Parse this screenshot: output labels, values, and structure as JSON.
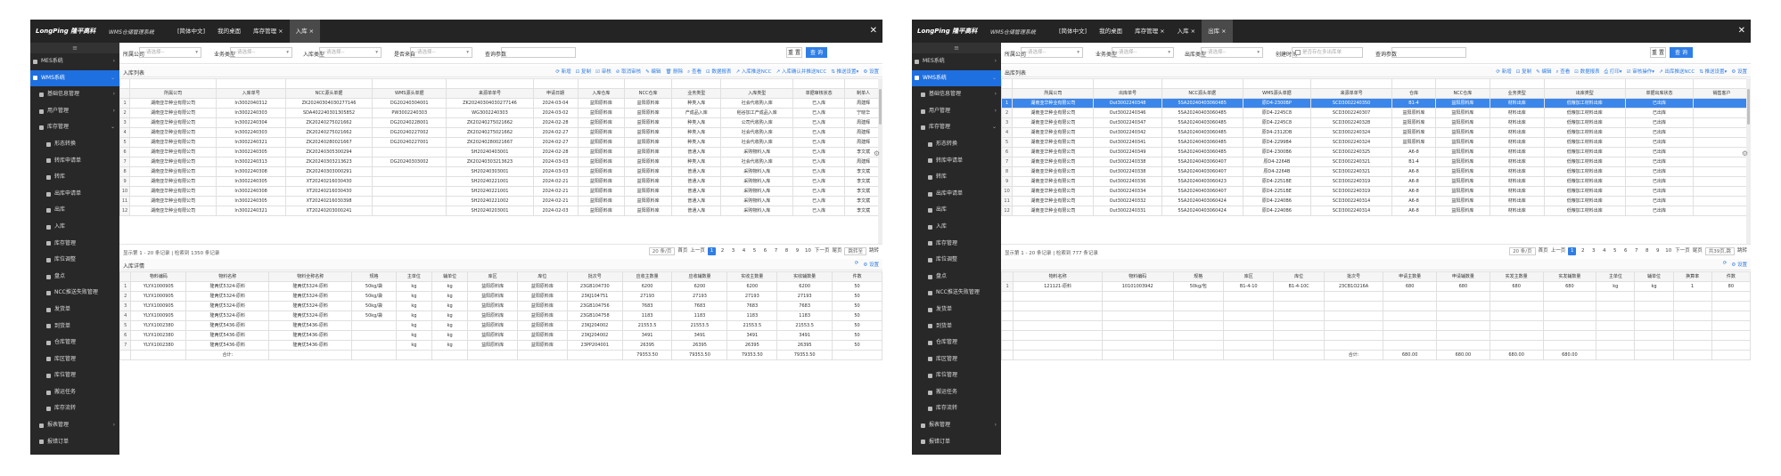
{
  "w1": {
    "logo": "LongPing 隆平高科",
    "system": "WMS仓储管理系统",
    "menus": [
      {
        "label": "[简体中文]"
      },
      {
        "label": "我的桌面"
      },
      {
        "label": "库存管理 ×"
      },
      {
        "label": "入库 ×"
      }
    ],
    "close": "✕",
    "sidebar": [
      {
        "label": "≡",
        "lvl": 0
      },
      {
        "label": "MES系统",
        "lvl": 1,
        "arrow": "›"
      },
      {
        "label": "WMS系统",
        "lvl": 1,
        "sel": true,
        "arrow": "⌄"
      },
      {
        "label": "基础信息管理",
        "lvl": 2,
        "arrow": "›"
      },
      {
        "label": "用户管理",
        "lvl": 2,
        "arrow": "›"
      },
      {
        "label": "库存管理",
        "lvl": 2,
        "arrow": "⌄"
      },
      {
        "label": "形态转换",
        "lvl": 3
      },
      {
        "label": "转库申请单",
        "lvl": 3
      },
      {
        "label": "转库",
        "lvl": 3
      },
      {
        "label": "出库申请单",
        "lvl": 3
      },
      {
        "label": "出库",
        "lvl": 3
      },
      {
        "label": "入库",
        "lvl": 3
      },
      {
        "label": "库存管理",
        "lvl": 3
      },
      {
        "label": "库位调整",
        "lvl": 3
      },
      {
        "label": "盘点",
        "lvl": 3
      },
      {
        "label": "NCC推送失败管理",
        "lvl": 3
      },
      {
        "label": "发货单",
        "lvl": 3
      },
      {
        "label": "到货单",
        "lvl": 3
      },
      {
        "label": "仓库管理",
        "lvl": 3
      },
      {
        "label": "库区管理",
        "lvl": 3
      },
      {
        "label": "库位管理",
        "lvl": 3
      },
      {
        "label": "搬运任务",
        "lvl": 3
      },
      {
        "label": "库存流转",
        "lvl": 3
      },
      {
        "label": "报表管理",
        "lvl": 2,
        "arrow": "›"
      },
      {
        "label": "报错订单",
        "lvl": 2
      }
    ],
    "filter": {
      "c1": "所属公司",
      "s1": "--请选择--",
      "c2": "业务类型",
      "s2": "--请选择--",
      "c3": "入库类型",
      "s3": "--请选择--",
      "c4": "是否来自",
      "s4": "--请选择--",
      "c5": "查询参数",
      "b1": "重 置",
      "b2": "查 询"
    },
    "top": {
      "title": "入库列表",
      "tools": [
        "⟳ 新增",
        "⊡ 复制",
        "☑ 审核",
        "⊘ 取消审核",
        "✎ 编辑",
        "🗑 删除",
        "⌕ 查看",
        "⊡ 数据报表",
        "↗ 入库推送NCC",
        "↗ 入库确认并推送NCC",
        "⇅ 推送设置▾",
        "⚙ 设置"
      ],
      "headers": [
        "",
        "所属公司",
        "入库单号",
        "NCC源头单据",
        "WMS源头单据",
        "来源单单号",
        "申请日期",
        "入库仓库",
        "NCC仓库",
        "业务类型",
        "入库类型",
        "单据审核状态",
        "制单人"
      ],
      "rows": [
        [
          "1",
          "湖南亚华种业有限公司",
          "In3002040312",
          "ZK20240304030277146",
          "DG20240304001",
          "ZK20240304030277146",
          "2024-03-04",
          "益阳原料库",
          "益阳原料库",
          "种类入库",
          "社会代收购入库",
          "已入库",
          "周建辉"
        ],
        [
          "2",
          "湖南亚华种业有限公司",
          "In3002240303",
          "SDA402240301305852",
          "PW3002240303",
          "WG3002240303",
          "2024-03-02",
          "益阳原料库",
          "益阳原料库",
          "产成品入库",
          "稻谷加工产成品入库",
          "已入库",
          "宁晓华"
        ],
        [
          "3",
          "湖南亚华种业有限公司",
          "In3002240304",
          "ZK20240275021662",
          "DG20240228001",
          "ZK20240275021662",
          "2024-02-28",
          "益阳原料库",
          "益阳原料库",
          "种类入库",
          "公司代收购入库",
          "已入库",
          "周建辉"
        ],
        [
          "4",
          "湖南亚华种业有限公司",
          "In3002240303",
          "ZK20240275021662",
          "DG20240227002",
          "ZK20240275021662",
          "2024-02-27",
          "益阳原料库",
          "益阳原料库",
          "种类入库",
          "社会代收购入库",
          "已入库",
          "周建辉"
        ],
        [
          "5",
          "湖南亚华种业有限公司",
          "In3002240321",
          "ZK20240280021667",
          "DG20240227001",
          "ZK20240280021667",
          "2024-02-27",
          "益阳原料库",
          "益阳原料库",
          "种类入库",
          "社会代收购入库",
          "已入库",
          "周建辉"
        ],
        [
          "6",
          "湖南亚华种业有限公司",
          "In3002240305",
          "ZK20240305300294",
          "",
          "SH20240403001",
          "2024-02-28",
          "益阳原料库",
          "益阳原料库",
          "普通入库",
          "采购物料入库",
          "已入库",
          "李文斌"
        ],
        [
          "7",
          "湖南亚华种业有限公司",
          "In3002240313",
          "ZK20240303213623",
          "DG20240303002",
          "ZK20240303213623",
          "2024-03-03",
          "益阳原料库",
          "益阳原料库",
          "种类入库",
          "社会代收购入库",
          "已入库",
          "周建辉"
        ],
        [
          "8",
          "湖南亚华种业有限公司",
          "In3002240308",
          "ZK20240303000291",
          "",
          "SH20240303001",
          "2024-03-03",
          "益阳原料库",
          "益阳原料库",
          "普通入库",
          "采购物料入库",
          "已入库",
          "李文斌"
        ],
        [
          "9",
          "湖南亚华种业有限公司",
          "In3002240305",
          "XT20240216030430",
          "",
          "SH20240221001",
          "2024-02-21",
          "益阳原料库",
          "益阳原料库",
          "普通入库",
          "采购物料入库",
          "已入库",
          "李文斌"
        ],
        [
          "10",
          "湖南亚华种业有限公司",
          "In3002240308",
          "XT20240216030430",
          "",
          "SH20240221001",
          "2024-02-21",
          "益阳原料库",
          "益阳原料库",
          "普通入库",
          "采购物料入库",
          "已入库",
          "李文斌"
        ],
        [
          "11",
          "湖南亚华种业有限公司",
          "In3002240305",
          "XT20240216030398",
          "",
          "SH20240221002",
          "2024-02-21",
          "益阳原料库",
          "益阳原料库",
          "普通入库",
          "采购物料入库",
          "已入库",
          "李文斌"
        ],
        [
          "12",
          "湖南亚华种业有限公司",
          "In3002240321",
          "XT20240203000241",
          "",
          "SH20240203001",
          "2024-02-03",
          "益阳原料库",
          "益阳原料库",
          "普通入库",
          "采购物料入库",
          "已入库",
          "李文斌"
        ]
      ],
      "info": "显示第 1 - 20 条记录 | 检索到 1350 条记录",
      "pager": [
        "20 条/页",
        "首页",
        "上一页",
        "1",
        "2",
        "3",
        "4",
        "5",
        "6",
        "7",
        "8",
        "9",
        "10",
        "下一页",
        "尾页",
        "跳转至",
        "跳转"
      ]
    },
    "bot": {
      "title": "入库详情",
      "tools": [
        "⟳",
        "⚙ 设置"
      ],
      "headers": [
        "",
        "物料编码",
        "物料名称",
        "物料全称名称",
        "规格",
        "主单位",
        "辅单位",
        "库区",
        "库位",
        "批次号",
        "应收主数量",
        "应收辅数量",
        "实收主数量",
        "实收辅数量",
        "件数"
      ],
      "rows": [
        [
          "1",
          "YLYX1000905",
          "隆两优5324-原料",
          "隆两优5324-原料",
          "50kg/袋",
          "kg",
          "kg",
          "益阳原料库",
          "益阳原料库",
          "23GB104730",
          "6200",
          "6200",
          "6200",
          "6200",
          "50"
        ],
        [
          "2",
          "YLYX1000905",
          "隆两优5324-原料",
          "隆两优5324-原料",
          "50kg/袋",
          "kg",
          "kg",
          "益阳原料库",
          "益阳原料库",
          "23KJ104751",
          "27193",
          "27193",
          "27193",
          "27193",
          "50"
        ],
        [
          "3",
          "YLYX1000905",
          "隆两优5324-原料",
          "隆两优5324-原料",
          "50kg/袋",
          "kg",
          "kg",
          "益阳原料库",
          "益阳原料库",
          "23GB104756",
          "7683",
          "7683",
          "7683",
          "7683",
          "50"
        ],
        [
          "4",
          "YLYX1000905",
          "隆两优5324-原料",
          "隆两优5324-原料",
          "50kg/袋",
          "kg",
          "kg",
          "益阳原料库",
          "益阳原料库",
          "23GB104758",
          "1183",
          "1183",
          "1183",
          "1183",
          "50"
        ],
        [
          "5",
          "YLYX1002380",
          "隆两优5436-原料",
          "隆两优5436-原料",
          "",
          "kg",
          "kg",
          "益阳原料库",
          "益阳原料库",
          "23KJ204002",
          "21553.5",
          "21553.5",
          "21553.5",
          "21553.5",
          "50"
        ],
        [
          "6",
          "YLYX1002380",
          "隆两优5436-原料",
          "隆两优5436-原料",
          "",
          "kg",
          "kg",
          "益阳原料库",
          "益阳原料库",
          "23KJ204002",
          "3491",
          "3491",
          "3491",
          "3491",
          "50"
        ],
        [
          "7",
          "YLYX1002380",
          "隆两优5436-原料",
          "隆两优5436-原料",
          "",
          "kg",
          "kg",
          "益阳原料库",
          "益阳原料库",
          "23PP204001",
          "26395",
          "26395",
          "26395",
          "26395",
          "50"
        ]
      ],
      "total": [
        "",
        "",
        "合计:",
        "",
        "",
        "",
        "",
        "",
        "",
        "",
        "79353.50",
        "79353.50",
        "79353.50",
        "79353.50",
        ""
      ]
    }
  },
  "w2": {
    "logo": "LongPing 隆平高科",
    "system": "WMS仓储管理系统",
    "menus": [
      {
        "label": "[简体中文]"
      },
      {
        "label": "我的桌面"
      },
      {
        "label": "库存管理 ×"
      },
      {
        "label": "入库 ×"
      },
      {
        "label": "出库 ×"
      }
    ],
    "close": "✕",
    "sidebar": [
      {
        "label": "≡",
        "lvl": 0
      },
      {
        "label": "MES系统",
        "lvl": 1,
        "arrow": "›"
      },
      {
        "label": "WMS系统",
        "lvl": 1,
        "sel": true,
        "arrow": "⌄"
      },
      {
        "label": "基础信息管理",
        "lvl": 2,
        "arrow": "›"
      },
      {
        "label": "用户管理",
        "lvl": 2,
        "arrow": "›"
      },
      {
        "label": "库存管理",
        "lvl": 2,
        "arrow": "⌄"
      },
      {
        "label": "形态转换",
        "lvl": 3
      },
      {
        "label": "转库申请单",
        "lvl": 3
      },
      {
        "label": "转库",
        "lvl": 3
      },
      {
        "label": "出库申请单",
        "lvl": 3
      },
      {
        "label": "出库",
        "lvl": 3
      },
      {
        "label": "入库",
        "lvl": 3
      },
      {
        "label": "库存管理",
        "lvl": 3
      },
      {
        "label": "库位调整",
        "lvl": 3
      },
      {
        "label": "盘点",
        "lvl": 3
      },
      {
        "label": "NCC推送失败管理",
        "lvl": 3
      },
      {
        "label": "发货单",
        "lvl": 3
      },
      {
        "label": "到货单",
        "lvl": 3
      },
      {
        "label": "仓库管理",
        "lvl": 3
      },
      {
        "label": "库区管理",
        "lvl": 3
      },
      {
        "label": "库位管理",
        "lvl": 3
      },
      {
        "label": "搬运任务",
        "lvl": 3
      },
      {
        "label": "库存流转",
        "lvl": 3
      },
      {
        "label": "报表管理",
        "lvl": 2,
        "arrow": "›"
      },
      {
        "label": "报错订单",
        "lvl": 2
      }
    ],
    "filter": {
      "c1": "所属公司",
      "s1": "--请选择--",
      "c2": "业务类型",
      "s2": "--请选择--",
      "c3": "出库类型",
      "s3": "--请选择--",
      "c4": "创建时间",
      "s4": "是否存在多出库单",
      "c5": "查询参数",
      "b1": "重 置",
      "b2": "查 询"
    },
    "top": {
      "title": "出库列表",
      "tools": [
        "⟳ 新增",
        "⊡ 复制",
        "✎ 编辑",
        "⌕ 查看",
        "⊡ 数据报表",
        "⎙ 打印▾",
        "☑ 审核操作▾",
        "↗ 出库推送NCC",
        "⇅ 推送设置▾",
        "⚙ 设置"
      ],
      "headers": [
        "",
        "所属公司",
        "出库单号",
        "NCC源头单据",
        "WMS源头单据",
        "来源单单号",
        "仓库",
        "NCC仓库",
        "业务类型",
        "出库类型",
        "单据出库状态",
        "销售客户"
      ],
      "rows": [
        [
          "1",
          "湖南亚华种业有限公司",
          "Out3002240348",
          "5SA20240403060485",
          "原D4-2300BP",
          "SCD3002240350",
          "B1-4",
          "益阳原料库",
          "材料出库",
          "低粮加工材料出库",
          "已出库",
          ""
        ],
        [
          "2",
          "湖南亚华种业有限公司",
          "Out3002240346",
          "5SA20240403060485",
          "原D4-2245C8",
          "SCD3002240307",
          "益阳原料库",
          "益阳原料库",
          "材料出库",
          "低粮加工材料出库",
          "已出库",
          ""
        ],
        [
          "3",
          "湖南亚华种业有限公司",
          "Out3002240347",
          "5SA20240403060485",
          "原D4-2245C8",
          "SCD3002240328",
          "益阳原料库",
          "益阳原料库",
          "材料出库",
          "低粮加工材料出库",
          "已出库",
          ""
        ],
        [
          "4",
          "湖南亚华种业有限公司",
          "Out3002240342",
          "5SA20240403060485",
          "原D4-2312DB",
          "SCD3002240324",
          "益阳原料库",
          "益阳原料库",
          "材料出库",
          "低粮加工材料出库",
          "已出库",
          ""
        ],
        [
          "5",
          "湖南亚华种业有限公司",
          "Out3002240341",
          "5SA20240403060485",
          "原D4-2299B4",
          "SCD3002240324",
          "益阳原料库",
          "益阳原料库",
          "材料出库",
          "低粮加工材料出库",
          "已出库",
          ""
        ],
        [
          "6",
          "湖南亚华种业有限公司",
          "Out3002240349",
          "5SA20240403060485",
          "原D4-2300B6",
          "SCD3002240325",
          "A6-8",
          "益阳原料库",
          "材料出库",
          "低粮加工材料出库",
          "已出库",
          ""
        ],
        [
          "7",
          "湖南亚华种业有限公司",
          "Out3002240338",
          "5SA20240403060407",
          "原D4-2264B",
          "SCD3002240321",
          "B1-4",
          "益阳原料库",
          "材料出库",
          "低粮加工材料出库",
          "已出库",
          ""
        ],
        [
          "8",
          "湖南亚华种业有限公司",
          "Out3002240338",
          "5SA20240403060407",
          "原D4-2264B",
          "SCD3002240321",
          "A6-8",
          "益阳原料库",
          "材料出库",
          "低粮加工材料出库",
          "已出库",
          ""
        ],
        [
          "9",
          "湖南亚华种业有限公司",
          "Out3002240336",
          "5SA20240403060423",
          "原D4-2251BE",
          "SCD3002240319",
          "A6-8",
          "益阳原料库",
          "材料出库",
          "低粮加工材料出库",
          "已出库",
          ""
        ],
        [
          "10",
          "湖南亚华种业有限公司",
          "Out3002240334",
          "5SA20240403060407",
          "原D4-2251BE",
          "SCD3002240319",
          "A6-8",
          "益阳原料库",
          "材料出库",
          "低粮加工材料出库",
          "已出库",
          ""
        ],
        [
          "11",
          "湖南亚华种业有限公司",
          "Out3002240332",
          "5SA20240403060424",
          "原D4-2240B6",
          "SCD3002240314",
          "A6-8",
          "益阳原料库",
          "材料出库",
          "低粮加工材料出库",
          "已出库",
          ""
        ],
        [
          "12",
          "湖南亚华种业有限公司",
          "Out3002240331",
          "5SA20240403060424",
          "原D4-2240B6",
          "SCD3002240314",
          "A6-8",
          "益阳原料库",
          "材料出库",
          "低粮加工材料出库",
          "已出库",
          ""
        ]
      ],
      "info": "显示第 1 - 20 条记录 | 检索到 777 条记录",
      "pager": [
        "20 条/页",
        "首页",
        "上一页",
        "1",
        "2",
        "3",
        "4",
        "5",
        "6",
        "7",
        "8",
        "9",
        "10",
        "下一页",
        "尾页",
        "共39页,跳",
        "跳转"
      ]
    },
    "bot": {
      "title": "",
      "tools": [
        "⟳",
        "⚙ 设置"
      ],
      "headers": [
        "",
        "物料名称",
        "物料编码",
        "规格",
        "库区",
        "库位",
        "批次号",
        "申请主数量",
        "申请辅数量",
        "实发主数量",
        "实发辅数量",
        "主单位",
        "辅单位",
        "换算率",
        "件数"
      ],
      "rows": [
        [
          "1",
          "121121-原料",
          "10101003942",
          "50kg/包",
          "B1-4-10",
          "B1-4-10C",
          "23CB1O216A",
          "680",
          "680",
          "680",
          "680",
          "kg",
          "kg",
          "1",
          "80"
        ]
      ],
      "total": [
        "",
        "",
        "",
        "",
        "",
        "",
        "合计:",
        "680.00",
        "680.00",
        "680.00",
        "680.00",
        "",
        "",
        "",
        ""
      ]
    }
  }
}
